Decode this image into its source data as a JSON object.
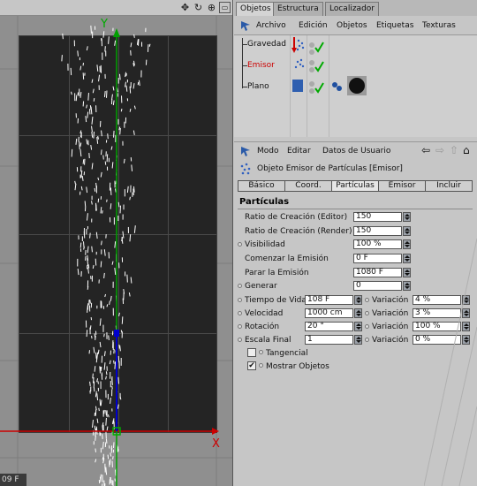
{
  "viewport": {
    "frame": "09 F",
    "axis_x": "X",
    "axis_y": "Y"
  },
  "obj_tabs": [
    "Objetos",
    "Estructura",
    "Localizador"
  ],
  "obj_menu": [
    "Archivo",
    "Edición",
    "Objetos",
    "Etiquetas",
    "Texturas"
  ],
  "tree": [
    {
      "name": "Gravedad",
      "color": "#111"
    },
    {
      "name": "Emisor",
      "color": "#c00"
    },
    {
      "name": "Plano",
      "color": "#111"
    }
  ],
  "attr_toolbar": [
    "Modo",
    "Editar",
    "Datos de Usuario"
  ],
  "attr_title": "Objeto Emisor de Partículas  [Emisor]",
  "attr_tabs": [
    "Básico",
    "Coord.",
    "Partículas",
    "Emisor",
    "Incluir"
  ],
  "section": "Partículas",
  "params": {
    "ratio_editor": {
      "label": "Ratio de Creación (Editor)",
      "value": "150"
    },
    "ratio_render": {
      "label": "Ratio de Creación (Render)",
      "value": "150"
    },
    "visibilidad": {
      "label": "Visibilidad",
      "value": "100 %"
    },
    "comenzar": {
      "label": "Comenzar la Emisión",
      "value": "0 F"
    },
    "parar": {
      "label": "Parar la Emisión",
      "value": "1080 F"
    },
    "generar": {
      "label": "Generar",
      "value": "0"
    },
    "tiempo": {
      "label": "Tiempo de Vida",
      "value": "108 F",
      "var_label": "Variación",
      "var_value": "4 %"
    },
    "velocidad": {
      "label": "Velocidad",
      "value": "1000 cm",
      "var_label": "Variación",
      "var_value": "3 %"
    },
    "rotacion": {
      "label": "Rotación",
      "value": "20 °",
      "var_label": "Variación",
      "var_value": "100 %"
    },
    "escala": {
      "label": "Escala Final",
      "value": "1",
      "var_label": "Variación",
      "var_value": "0 %"
    }
  },
  "checks": {
    "tangencial": {
      "label": "Tangencial",
      "checked": false
    },
    "mostrar": {
      "label": "Mostrar Objetos",
      "checked": true
    }
  }
}
